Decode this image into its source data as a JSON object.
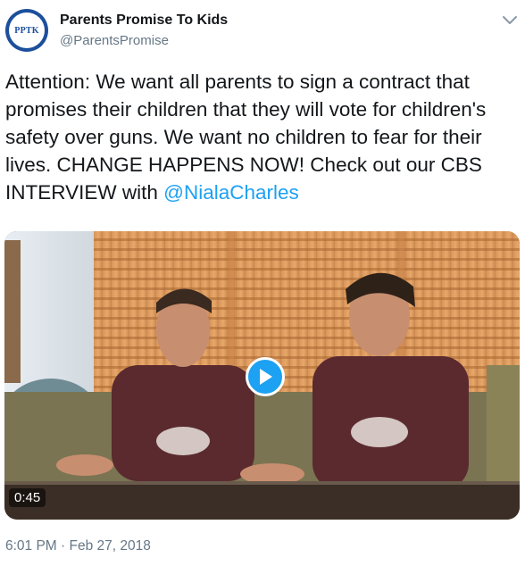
{
  "author": {
    "display_name": "Parents Promise To Kids",
    "handle": "@ParentsPromise",
    "avatar_text": "PPTK"
  },
  "tweet": {
    "text_before_mention": "Attention: We want all parents to sign a contract that promises their children that they will vote for children's safety over guns. We want no children to fear for their lives. CHANGE HAPPENS NOW! Check out our CBS INTERVIEW with ",
    "mention": "@NialaCharles",
    "timestamp": "6:01 PM · Feb 27, 2018"
  },
  "video": {
    "duration": "0:45",
    "play_icon": "play-icon"
  },
  "menu": {
    "icon": "chevron-down-icon"
  },
  "colors": {
    "link": "#1da1f2",
    "secondary_text": "#657786",
    "avatar_blue": "#1c4f9c"
  }
}
